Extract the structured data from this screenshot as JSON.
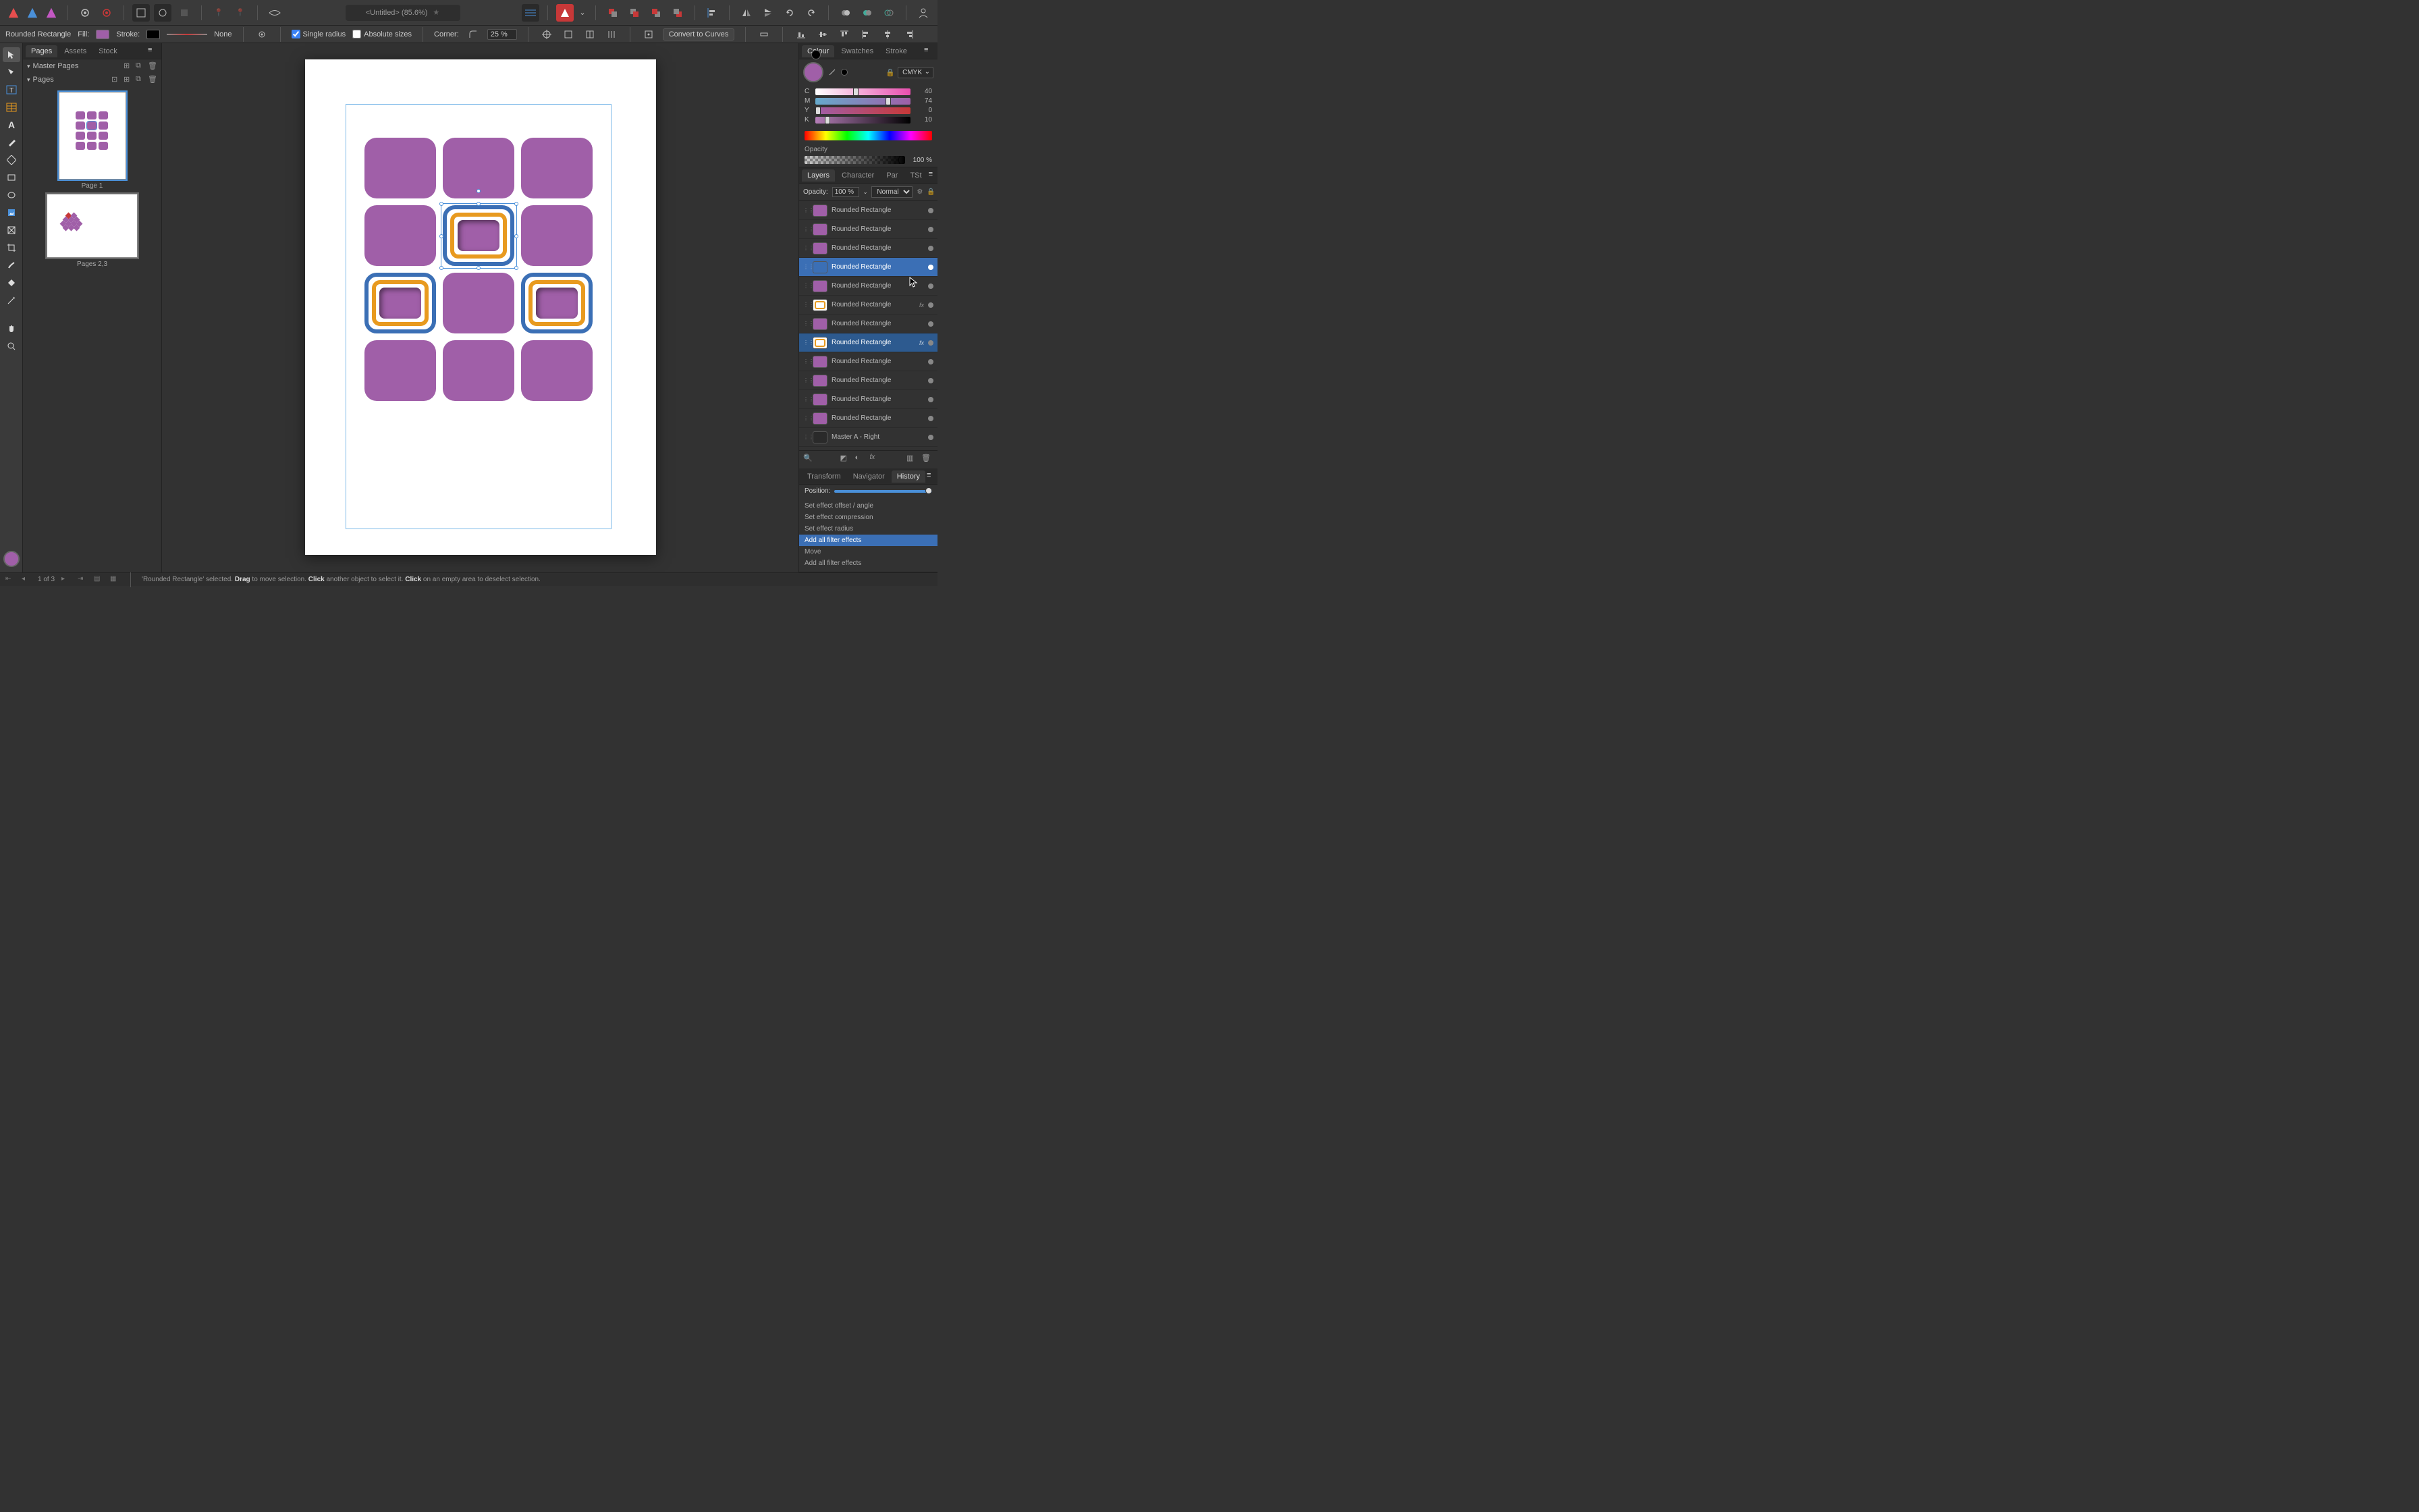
{
  "doc_title": "<Untitled> (85.6%)",
  "context": {
    "tool_name": "Rounded Rectangle",
    "fill_label": "Fill:",
    "fill_color": "#a05fa8",
    "stroke_label": "Stroke:",
    "stroke_width": "None",
    "single_radius": "Single radius",
    "absolute_sizes": "Absolute sizes",
    "corner_label": "Corner:",
    "corner_value": "25 %",
    "convert": "Convert to Curves"
  },
  "left_tabs": [
    "Pages",
    "Assets",
    "Stock"
  ],
  "master_pages_label": "Master Pages",
  "pages_label": "Pages",
  "page1_label": "Page 1",
  "pages23_label": "Pages 2,3",
  "right_tabs_colour": [
    "Colour",
    "Swatches",
    "Stroke"
  ],
  "colour_mode": "CMYK",
  "cmyk": {
    "C": 40,
    "M": 74,
    "Y": 0,
    "K": 10
  },
  "opacity_label": "Opacity",
  "opacity_value": "100 %",
  "right_tabs_layers": [
    "Layers",
    "Character",
    "Par",
    "TSt"
  ],
  "layers_opacity_label": "Opacity:",
  "layers_opacity": "100 %",
  "blend_mode": "Normal",
  "layers": [
    {
      "name": "Rounded Rectangle",
      "thumb": "purple"
    },
    {
      "name": "Rounded Rectangle",
      "thumb": "purple"
    },
    {
      "name": "Rounded Rectangle",
      "thumb": "purple"
    },
    {
      "name": "Rounded Rectangle",
      "thumb": "blue",
      "sel": true
    },
    {
      "name": "Rounded Rectangle",
      "thumb": "purple"
    },
    {
      "name": "Rounded Rectangle",
      "thumb": "ring",
      "fx": true
    },
    {
      "name": "Rounded Rectangle",
      "thumb": "purple"
    },
    {
      "name": "Rounded Rectangle",
      "thumb": "ring",
      "fx": true,
      "sel2": true
    },
    {
      "name": "Rounded Rectangle",
      "thumb": "purple"
    },
    {
      "name": "Rounded Rectangle",
      "thumb": "purple"
    },
    {
      "name": "Rounded Rectangle",
      "thumb": "purple"
    },
    {
      "name": "Rounded Rectangle",
      "thumb": "purple"
    },
    {
      "name": "Master A - Right",
      "thumb": "master"
    }
  ],
  "right_tabs_history": [
    "Transform",
    "Navigator",
    "History"
  ],
  "history_position_label": "Position:",
  "history": [
    {
      "label": "Set effect offset / angle"
    },
    {
      "label": "Set effect compression"
    },
    {
      "label": "Set effect radius"
    },
    {
      "label": "Add all filter effects",
      "sel": true
    },
    {
      "label": "Move"
    },
    {
      "label": "Add all filter effects"
    }
  ],
  "status": {
    "page_nav": "1 of 3",
    "hint": "'Rounded Rectangle' selected. Drag to move selection. Click another object to select it. Click on an empty area to deselect selection."
  },
  "colors": {
    "accent": "#3b6fb5",
    "purple": "#a05fa8",
    "orange": "#e89a1f"
  }
}
